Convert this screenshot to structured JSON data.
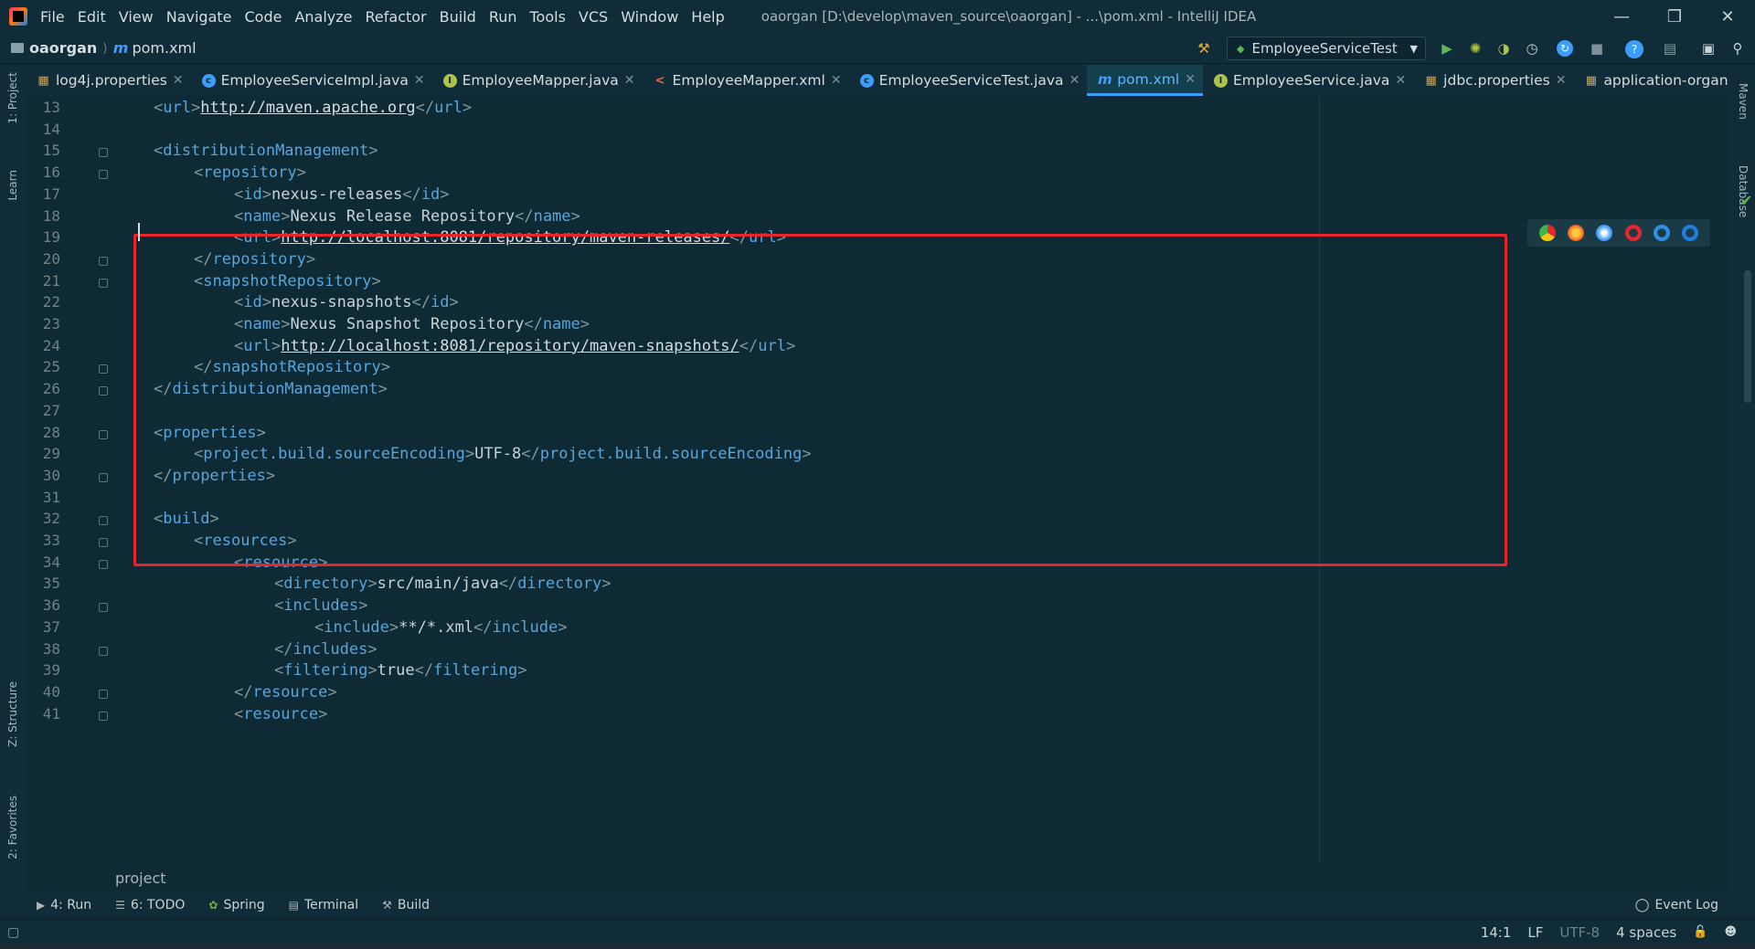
{
  "menubar": {
    "items": [
      "File",
      "Edit",
      "View",
      "Navigate",
      "Code",
      "Analyze",
      "Refactor",
      "Build",
      "Run",
      "Tools",
      "VCS",
      "Window",
      "Help"
    ],
    "title": "oaorgan [D:\\develop\\maven_source\\oaorgan] - ...\\pom.xml - IntelliJ IDEA"
  },
  "navbar": {
    "project": "oaorgan",
    "file": "pom.xml",
    "run_config": "EmployeeServiceTest"
  },
  "tabs": [
    {
      "label": "log4j.properties",
      "icon": "properties-file-icon",
      "color": "#c9a35b"
    },
    {
      "label": "EmployeeServiceImpl.java",
      "icon": "class-icon",
      "color": "#3d9dfc"
    },
    {
      "label": "EmployeeMapper.java",
      "icon": "interface-icon",
      "color": "#b0c24a"
    },
    {
      "label": "EmployeeMapper.xml",
      "icon": "xml-file-icon",
      "color": "#e06c4e"
    },
    {
      "label": "EmployeeServiceTest.java",
      "icon": "test-class-icon",
      "color": "#3d9dfc"
    },
    {
      "label": "pom.xml",
      "icon": "maven-icon",
      "color": "#3d9dfc"
    },
    {
      "label": "EmployeeService.java",
      "icon": "interface-icon",
      "color": "#b0c24a"
    },
    {
      "label": "jdbc.properties",
      "icon": "properties-file-icon",
      "color": "#c9a35b"
    },
    {
      "label": "application-organ.",
      "icon": "properties-file-icon",
      "color": "#c9a35b"
    }
  ],
  "left_strip": {
    "project": "1: Project",
    "learn": "Learn",
    "structure": "Z: Structure",
    "favorites": "2: Favorites"
  },
  "right_strip": {
    "maven": "Maven",
    "database": "Database"
  },
  "editor": {
    "lines": [
      {
        "n": "13",
        "indent": 1,
        "parts": [
          [
            "br",
            "<"
          ],
          [
            "tag",
            "url"
          ],
          [
            "br",
            ">"
          ],
          [
            "url",
            "http://maven.apache.org"
          ],
          [
            "br",
            "</"
          ],
          [
            "tag",
            "url"
          ],
          [
            "br",
            ">"
          ]
        ]
      },
      {
        "n": "14",
        "indent": 0,
        "parts": []
      },
      {
        "n": "15",
        "indent": 1,
        "parts": [
          [
            "br",
            "<"
          ],
          [
            "tag",
            "distributionManagement"
          ],
          [
            "br",
            ">"
          ]
        ]
      },
      {
        "n": "16",
        "indent": 2,
        "parts": [
          [
            "br",
            "<"
          ],
          [
            "tag",
            "repository"
          ],
          [
            "br",
            ">"
          ]
        ]
      },
      {
        "n": "17",
        "indent": 3,
        "parts": [
          [
            "br",
            "<"
          ],
          [
            "tag",
            "id"
          ],
          [
            "br",
            ">"
          ],
          [
            "txt",
            "nexus-releases"
          ],
          [
            "br",
            "</"
          ],
          [
            "tag",
            "id"
          ],
          [
            "br",
            ">"
          ]
        ]
      },
      {
        "n": "18",
        "indent": 3,
        "parts": [
          [
            "br",
            "<"
          ],
          [
            "tag",
            "name"
          ],
          [
            "br",
            ">"
          ],
          [
            "txt",
            "Nexus Release Repository"
          ],
          [
            "br",
            "</"
          ],
          [
            "tag",
            "name"
          ],
          [
            "br",
            ">"
          ]
        ]
      },
      {
        "n": "19",
        "indent": 3,
        "parts": [
          [
            "br",
            "<"
          ],
          [
            "tag",
            "url"
          ],
          [
            "br",
            ">"
          ],
          [
            "url",
            "http://localhost:8081/repository/maven-releases/"
          ],
          [
            "br",
            "</"
          ],
          [
            "tag",
            "url"
          ],
          [
            "br",
            ">"
          ]
        ]
      },
      {
        "n": "20",
        "indent": 2,
        "parts": [
          [
            "br",
            "</"
          ],
          [
            "tag",
            "repository"
          ],
          [
            "br",
            ">"
          ]
        ]
      },
      {
        "n": "21",
        "indent": 2,
        "parts": [
          [
            "br",
            "<"
          ],
          [
            "tag",
            "snapshotRepository"
          ],
          [
            "br",
            ">"
          ]
        ]
      },
      {
        "n": "22",
        "indent": 3,
        "parts": [
          [
            "br",
            "<"
          ],
          [
            "tag",
            "id"
          ],
          [
            "br",
            ">"
          ],
          [
            "txt",
            "nexus-snapshots"
          ],
          [
            "br",
            "</"
          ],
          [
            "tag",
            "id"
          ],
          [
            "br",
            ">"
          ]
        ]
      },
      {
        "n": "23",
        "indent": 3,
        "parts": [
          [
            "br",
            "<"
          ],
          [
            "tag",
            "name"
          ],
          [
            "br",
            ">"
          ],
          [
            "txt",
            "Nexus Snapshot Repository"
          ],
          [
            "br",
            "</"
          ],
          [
            "tag",
            "name"
          ],
          [
            "br",
            ">"
          ]
        ]
      },
      {
        "n": "24",
        "indent": 3,
        "parts": [
          [
            "br",
            "<"
          ],
          [
            "tag",
            "url"
          ],
          [
            "br",
            ">"
          ],
          [
            "url",
            "http://localhost:8081/repository/maven-snapshots/"
          ],
          [
            "br",
            "</"
          ],
          [
            "tag",
            "url"
          ],
          [
            "br",
            ">"
          ]
        ]
      },
      {
        "n": "25",
        "indent": 2,
        "parts": [
          [
            "br",
            "</"
          ],
          [
            "tag",
            "snapshotRepository"
          ],
          [
            "br",
            ">"
          ]
        ]
      },
      {
        "n": "26",
        "indent": 1,
        "parts": [
          [
            "br",
            "</"
          ],
          [
            "tag",
            "distributionManagement"
          ],
          [
            "br",
            ">"
          ]
        ]
      },
      {
        "n": "27",
        "indent": 0,
        "parts": []
      },
      {
        "n": "28",
        "indent": 1,
        "parts": [
          [
            "br",
            "<"
          ],
          [
            "tag",
            "properties"
          ],
          [
            "br",
            ">"
          ]
        ]
      },
      {
        "n": "29",
        "indent": 2,
        "parts": [
          [
            "br",
            "<"
          ],
          [
            "tag",
            "project.build.sourceEncoding"
          ],
          [
            "br",
            ">"
          ],
          [
            "txt",
            "UTF-8"
          ],
          [
            "br",
            "</"
          ],
          [
            "tag",
            "project.build.sourceEncoding"
          ],
          [
            "br",
            ">"
          ]
        ]
      },
      {
        "n": "30",
        "indent": 1,
        "parts": [
          [
            "br",
            "</"
          ],
          [
            "tag",
            "properties"
          ],
          [
            "br",
            ">"
          ]
        ]
      },
      {
        "n": "31",
        "indent": 0,
        "parts": []
      },
      {
        "n": "32",
        "indent": 1,
        "parts": [
          [
            "br",
            "<"
          ],
          [
            "tag",
            "build"
          ],
          [
            "br",
            ">"
          ]
        ]
      },
      {
        "n": "33",
        "indent": 2,
        "parts": [
          [
            "br",
            "<"
          ],
          [
            "tag",
            "resources"
          ],
          [
            "br",
            ">"
          ]
        ]
      },
      {
        "n": "34",
        "indent": 3,
        "parts": [
          [
            "br",
            "<"
          ],
          [
            "tag",
            "resource"
          ],
          [
            "br",
            ">"
          ]
        ]
      },
      {
        "n": "35",
        "indent": 4,
        "parts": [
          [
            "br",
            "<"
          ],
          [
            "tag",
            "directory"
          ],
          [
            "br",
            ">"
          ],
          [
            "txt",
            "src/main/java"
          ],
          [
            "br",
            "</"
          ],
          [
            "tag",
            "directory"
          ],
          [
            "br",
            ">"
          ]
        ]
      },
      {
        "n": "36",
        "indent": 4,
        "parts": [
          [
            "br",
            "<"
          ],
          [
            "tag",
            "includes"
          ],
          [
            "br",
            ">"
          ]
        ]
      },
      {
        "n": "37",
        "indent": 5,
        "parts": [
          [
            "br",
            "<"
          ],
          [
            "tag",
            "include"
          ],
          [
            "br",
            ">"
          ],
          [
            "txt",
            "**/*.xml"
          ],
          [
            "br",
            "</"
          ],
          [
            "tag",
            "include"
          ],
          [
            "br",
            ">"
          ]
        ]
      },
      {
        "n": "38",
        "indent": 4,
        "parts": [
          [
            "br",
            "</"
          ],
          [
            "tag",
            "includes"
          ],
          [
            "br",
            ">"
          ]
        ]
      },
      {
        "n": "39",
        "indent": 4,
        "parts": [
          [
            "br",
            "<"
          ],
          [
            "tag",
            "filtering"
          ],
          [
            "br",
            ">"
          ],
          [
            "txt",
            "true"
          ],
          [
            "br",
            "</"
          ],
          [
            "tag",
            "filtering"
          ],
          [
            "br",
            ">"
          ]
        ]
      },
      {
        "n": "40",
        "indent": 3,
        "parts": [
          [
            "br",
            "</"
          ],
          [
            "tag",
            "resource"
          ],
          [
            "br",
            ">"
          ]
        ]
      },
      {
        "n": "41",
        "indent": 3,
        "parts": [
          [
            "br",
            "<"
          ],
          [
            "tag",
            "resource"
          ],
          [
            "br",
            ">"
          ]
        ]
      }
    ],
    "fold_lines": [
      "15",
      "16",
      "20",
      "21",
      "25",
      "26",
      "28",
      "30",
      "32",
      "33",
      "34",
      "36",
      "38",
      "40",
      "41"
    ],
    "bottom_breadcrumb": "project"
  },
  "bottom_tools": [
    {
      "label": "4: Run",
      "icon": "run-icon"
    },
    {
      "label": "6: TODO",
      "icon": "todo-icon"
    },
    {
      "label": "Spring",
      "icon": "spring-icon"
    },
    {
      "label": "Terminal",
      "icon": "terminal-icon"
    },
    {
      "label": "Build",
      "icon": "build-icon"
    }
  ],
  "event_log": "Event Log",
  "status": {
    "position": "14:1",
    "line_sep": "LF",
    "encoding": "UTF-8",
    "indent": "4 spaces"
  },
  "colors": {
    "background": "#0e2a35",
    "tag": "#58a5dc",
    "highlight": "#e8252a",
    "accent": "#3d9dfc"
  }
}
